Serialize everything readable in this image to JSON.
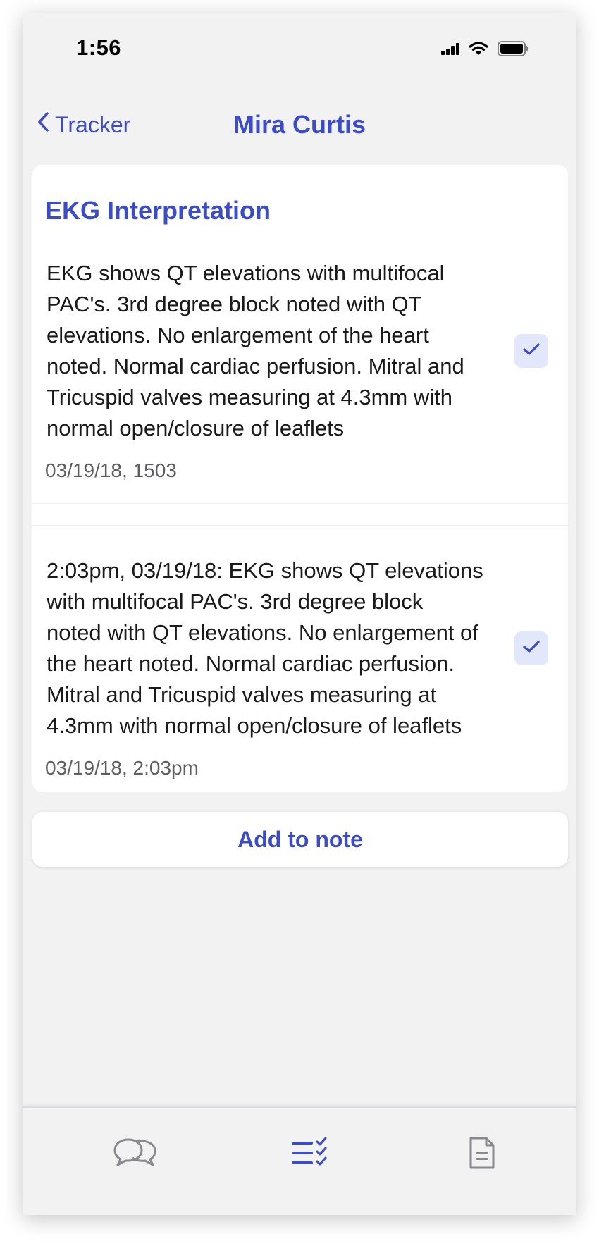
{
  "status_bar": {
    "time": "1:56"
  },
  "nav": {
    "back_label": "Tracker",
    "title": "Mira Curtis"
  },
  "card": {
    "heading": "EKG Interpretation",
    "entries": [
      {
        "text": "EKG shows QT elevations with multifocal PAC's. 3rd degree block noted with QT elevations. No enlargement of the heart noted. Normal cardiac perfusion. Mitral and Tricuspid valves measuring at 4.3mm with normal open/closure of leaflets",
        "date": "03/19/18, 1503",
        "checked": true
      },
      {
        "text": "2:03pm, 03/19/18: EKG shows QT elevations with multifocal PAC's. 3rd degree block noted with QT elevations. No enlargement of the heart noted. Normal cardiac perfusion. Mitral and Tricuspid valves measuring at 4.3mm with normal open/closure of leaflets",
        "date": "03/19/18, 2:03pm",
        "checked": true
      }
    ]
  },
  "actions": {
    "add_to_note_label": "Add to note"
  },
  "tab_bar": {
    "tabs": [
      {
        "icon": "chat-bubbles-icon",
        "active": false
      },
      {
        "icon": "checklist-icon",
        "active": true
      },
      {
        "icon": "document-icon",
        "active": false
      }
    ]
  },
  "colors": {
    "accent": "#3b4cc4",
    "background": "#f2f2f3",
    "card": "#ffffff",
    "check_bg": "#e3e7fb",
    "inactive_icon": "#8a8a8e"
  }
}
